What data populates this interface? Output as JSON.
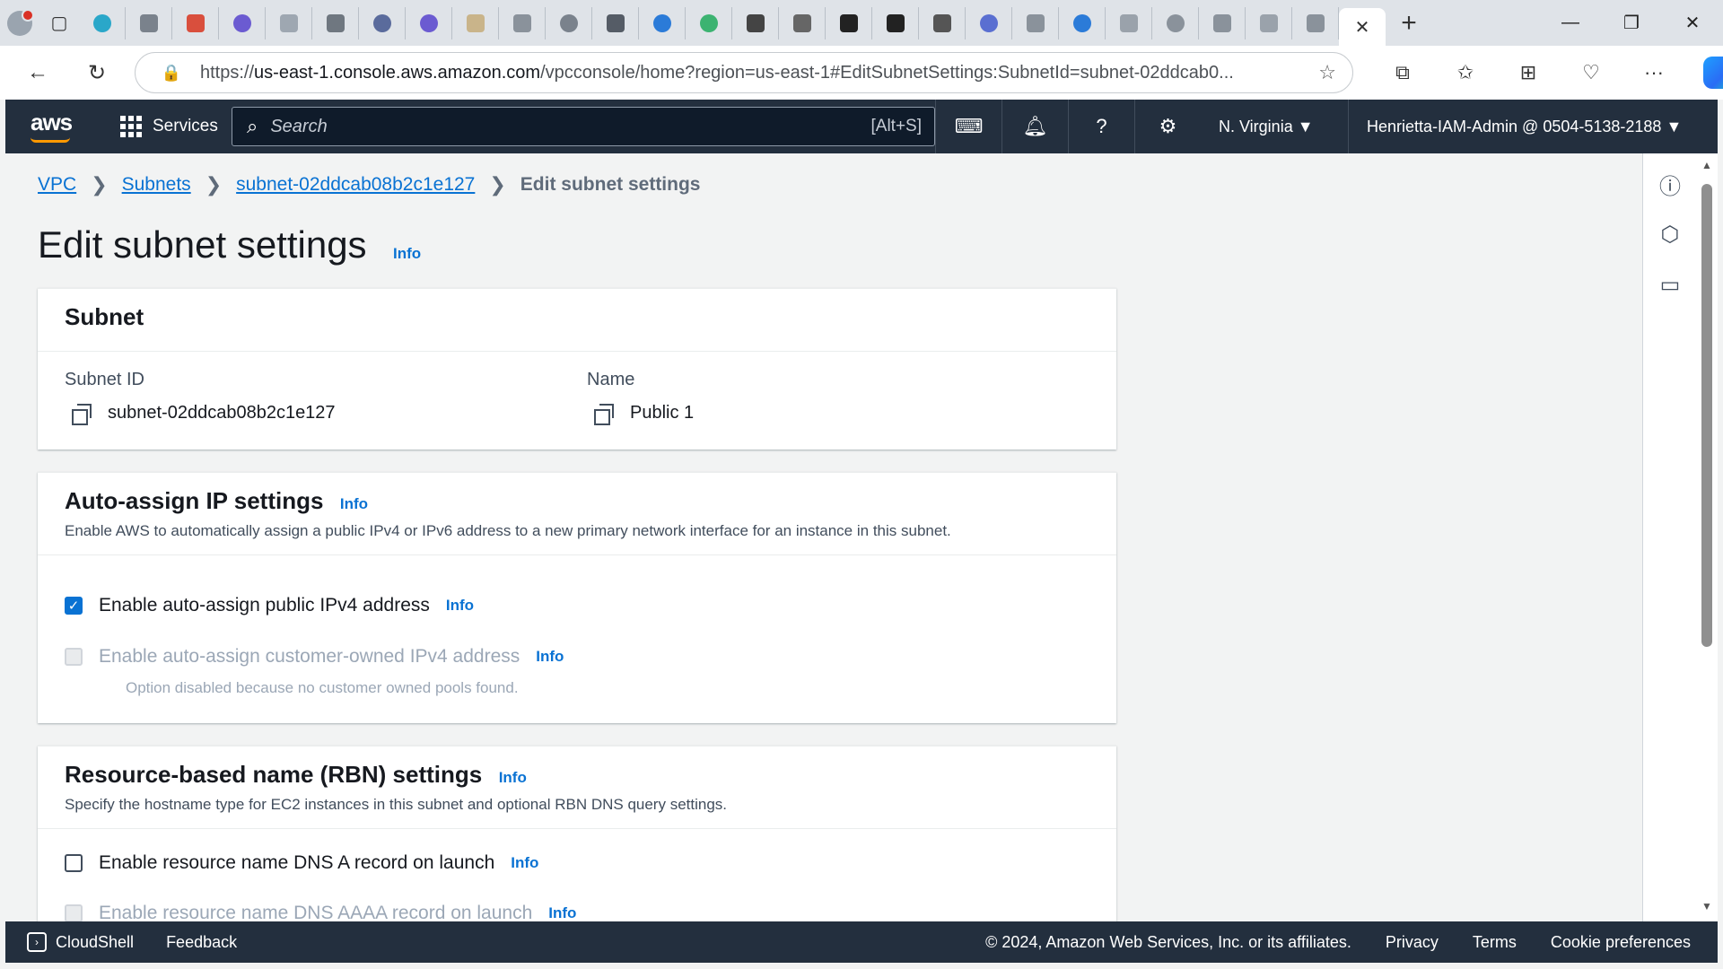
{
  "browser": {
    "url_prefix": "https://",
    "url_host": "us-east-1.console.aws.amazon.com",
    "url_rest": "/vpcconsole/home?region=us-east-1#EditSubnetSettings:SubnetId=subnet-02ddcab0...",
    "active_tab_close": "✕",
    "new_tab": "+"
  },
  "aws_nav": {
    "logo": "aws",
    "services_label": "Services",
    "search_placeholder": "Search",
    "search_shortcut": "[Alt+S]",
    "region": "N. Virginia ▼",
    "account": "Henrietta-IAM-Admin @ 0504-5138-2188 ▼"
  },
  "breadcrumb": {
    "items": [
      "VPC",
      "Subnets",
      "subnet-02ddcab08b2c1e127"
    ],
    "current": "Edit subnet settings"
  },
  "page": {
    "title": "Edit subnet settings",
    "info": "Info"
  },
  "subnet_panel": {
    "heading": "Subnet",
    "subnet_id_label": "Subnet ID",
    "subnet_id_value": "subnet-02ddcab08b2c1e127",
    "name_label": "Name",
    "name_value": "Public 1"
  },
  "auto_ip_panel": {
    "heading": "Auto-assign IP settings",
    "info": "Info",
    "description": "Enable AWS to automatically assign a public IPv4 or IPv6 address to a new primary network interface for an instance in this subnet.",
    "option1_label": "Enable auto-assign public IPv4 address",
    "option1_checked": true,
    "option2_label": "Enable auto-assign customer-owned IPv4 address",
    "option2_hint": "Option disabled because no customer owned pools found."
  },
  "rbn_panel": {
    "heading": "Resource-based name (RBN) settings",
    "info": "Info",
    "description": "Specify the hostname type for EC2 instances in this subnet and optional RBN DNS query settings.",
    "option1_label": "Enable resource name DNS A record on launch",
    "option2_label": "Enable resource name DNS AAAA record on launch"
  },
  "footer": {
    "cloudshell": "CloudShell",
    "feedback": "Feedback",
    "copyright": "© 2024, Amazon Web Services, Inc. or its affiliates.",
    "privacy": "Privacy",
    "terms": "Terms",
    "cookies": "Cookie preferences"
  }
}
